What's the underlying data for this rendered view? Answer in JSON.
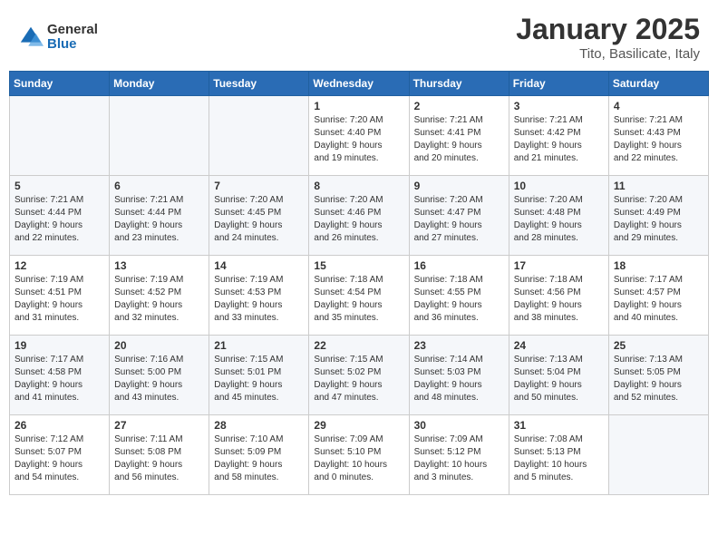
{
  "logo": {
    "general": "General",
    "blue": "Blue"
  },
  "header": {
    "month": "January 2025",
    "location": "Tito, Basilicate, Italy"
  },
  "weekdays": [
    "Sunday",
    "Monday",
    "Tuesday",
    "Wednesday",
    "Thursday",
    "Friday",
    "Saturday"
  ],
  "weeks": [
    [
      {
        "day": "",
        "info": ""
      },
      {
        "day": "",
        "info": ""
      },
      {
        "day": "",
        "info": ""
      },
      {
        "day": "1",
        "info": "Sunrise: 7:20 AM\nSunset: 4:40 PM\nDaylight: 9 hours\nand 19 minutes."
      },
      {
        "day": "2",
        "info": "Sunrise: 7:21 AM\nSunset: 4:41 PM\nDaylight: 9 hours\nand 20 minutes."
      },
      {
        "day": "3",
        "info": "Sunrise: 7:21 AM\nSunset: 4:42 PM\nDaylight: 9 hours\nand 21 minutes."
      },
      {
        "day": "4",
        "info": "Sunrise: 7:21 AM\nSunset: 4:43 PM\nDaylight: 9 hours\nand 22 minutes."
      }
    ],
    [
      {
        "day": "5",
        "info": "Sunrise: 7:21 AM\nSunset: 4:44 PM\nDaylight: 9 hours\nand 22 minutes."
      },
      {
        "day": "6",
        "info": "Sunrise: 7:21 AM\nSunset: 4:44 PM\nDaylight: 9 hours\nand 23 minutes."
      },
      {
        "day": "7",
        "info": "Sunrise: 7:20 AM\nSunset: 4:45 PM\nDaylight: 9 hours\nand 24 minutes."
      },
      {
        "day": "8",
        "info": "Sunrise: 7:20 AM\nSunset: 4:46 PM\nDaylight: 9 hours\nand 26 minutes."
      },
      {
        "day": "9",
        "info": "Sunrise: 7:20 AM\nSunset: 4:47 PM\nDaylight: 9 hours\nand 27 minutes."
      },
      {
        "day": "10",
        "info": "Sunrise: 7:20 AM\nSunset: 4:48 PM\nDaylight: 9 hours\nand 28 minutes."
      },
      {
        "day": "11",
        "info": "Sunrise: 7:20 AM\nSunset: 4:49 PM\nDaylight: 9 hours\nand 29 minutes."
      }
    ],
    [
      {
        "day": "12",
        "info": "Sunrise: 7:19 AM\nSunset: 4:51 PM\nDaylight: 9 hours\nand 31 minutes."
      },
      {
        "day": "13",
        "info": "Sunrise: 7:19 AM\nSunset: 4:52 PM\nDaylight: 9 hours\nand 32 minutes."
      },
      {
        "day": "14",
        "info": "Sunrise: 7:19 AM\nSunset: 4:53 PM\nDaylight: 9 hours\nand 33 minutes."
      },
      {
        "day": "15",
        "info": "Sunrise: 7:18 AM\nSunset: 4:54 PM\nDaylight: 9 hours\nand 35 minutes."
      },
      {
        "day": "16",
        "info": "Sunrise: 7:18 AM\nSunset: 4:55 PM\nDaylight: 9 hours\nand 36 minutes."
      },
      {
        "day": "17",
        "info": "Sunrise: 7:18 AM\nSunset: 4:56 PM\nDaylight: 9 hours\nand 38 minutes."
      },
      {
        "day": "18",
        "info": "Sunrise: 7:17 AM\nSunset: 4:57 PM\nDaylight: 9 hours\nand 40 minutes."
      }
    ],
    [
      {
        "day": "19",
        "info": "Sunrise: 7:17 AM\nSunset: 4:58 PM\nDaylight: 9 hours\nand 41 minutes."
      },
      {
        "day": "20",
        "info": "Sunrise: 7:16 AM\nSunset: 5:00 PM\nDaylight: 9 hours\nand 43 minutes."
      },
      {
        "day": "21",
        "info": "Sunrise: 7:15 AM\nSunset: 5:01 PM\nDaylight: 9 hours\nand 45 minutes."
      },
      {
        "day": "22",
        "info": "Sunrise: 7:15 AM\nSunset: 5:02 PM\nDaylight: 9 hours\nand 47 minutes."
      },
      {
        "day": "23",
        "info": "Sunrise: 7:14 AM\nSunset: 5:03 PM\nDaylight: 9 hours\nand 48 minutes."
      },
      {
        "day": "24",
        "info": "Sunrise: 7:13 AM\nSunset: 5:04 PM\nDaylight: 9 hours\nand 50 minutes."
      },
      {
        "day": "25",
        "info": "Sunrise: 7:13 AM\nSunset: 5:05 PM\nDaylight: 9 hours\nand 52 minutes."
      }
    ],
    [
      {
        "day": "26",
        "info": "Sunrise: 7:12 AM\nSunset: 5:07 PM\nDaylight: 9 hours\nand 54 minutes."
      },
      {
        "day": "27",
        "info": "Sunrise: 7:11 AM\nSunset: 5:08 PM\nDaylight: 9 hours\nand 56 minutes."
      },
      {
        "day": "28",
        "info": "Sunrise: 7:10 AM\nSunset: 5:09 PM\nDaylight: 9 hours\nand 58 minutes."
      },
      {
        "day": "29",
        "info": "Sunrise: 7:09 AM\nSunset: 5:10 PM\nDaylight: 10 hours\nand 0 minutes."
      },
      {
        "day": "30",
        "info": "Sunrise: 7:09 AM\nSunset: 5:12 PM\nDaylight: 10 hours\nand 3 minutes."
      },
      {
        "day": "31",
        "info": "Sunrise: 7:08 AM\nSunset: 5:13 PM\nDaylight: 10 hours\nand 5 minutes."
      },
      {
        "day": "",
        "info": ""
      }
    ]
  ]
}
